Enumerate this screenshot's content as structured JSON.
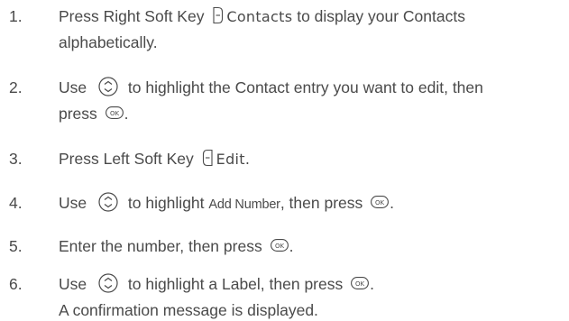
{
  "steps": [
    {
      "number": "1.",
      "pre": "Press Right Soft Key",
      "softkey_label": "Contacts",
      "post": "to display your Contacts",
      "line2": "alphabetically."
    },
    {
      "number": "2.",
      "pre": "Use",
      "post": "to highlight the Contact entry you want to edit, then",
      "line2_pre": "press",
      "line2_post": "."
    },
    {
      "number": "3.",
      "pre": "Press Left Soft Key",
      "softkey_label": "Edit."
    },
    {
      "number": "4.",
      "pre": "Use",
      "mid": "to highlight",
      "option": "Add Number",
      "post": ", then press",
      "end": "."
    },
    {
      "number": "5.",
      "pre": "Enter the number, then press",
      "end": "."
    },
    {
      "number": "6.",
      "pre": "Use",
      "post": "to highlight a Label, then press",
      "end": ".",
      "line2": "A confirmation message is displayed."
    }
  ],
  "icons": {
    "ok_key": "OK",
    "nav": "nav-key-icon",
    "right_soft": "right-soft-key-icon",
    "left_soft": "left-soft-key-icon"
  }
}
